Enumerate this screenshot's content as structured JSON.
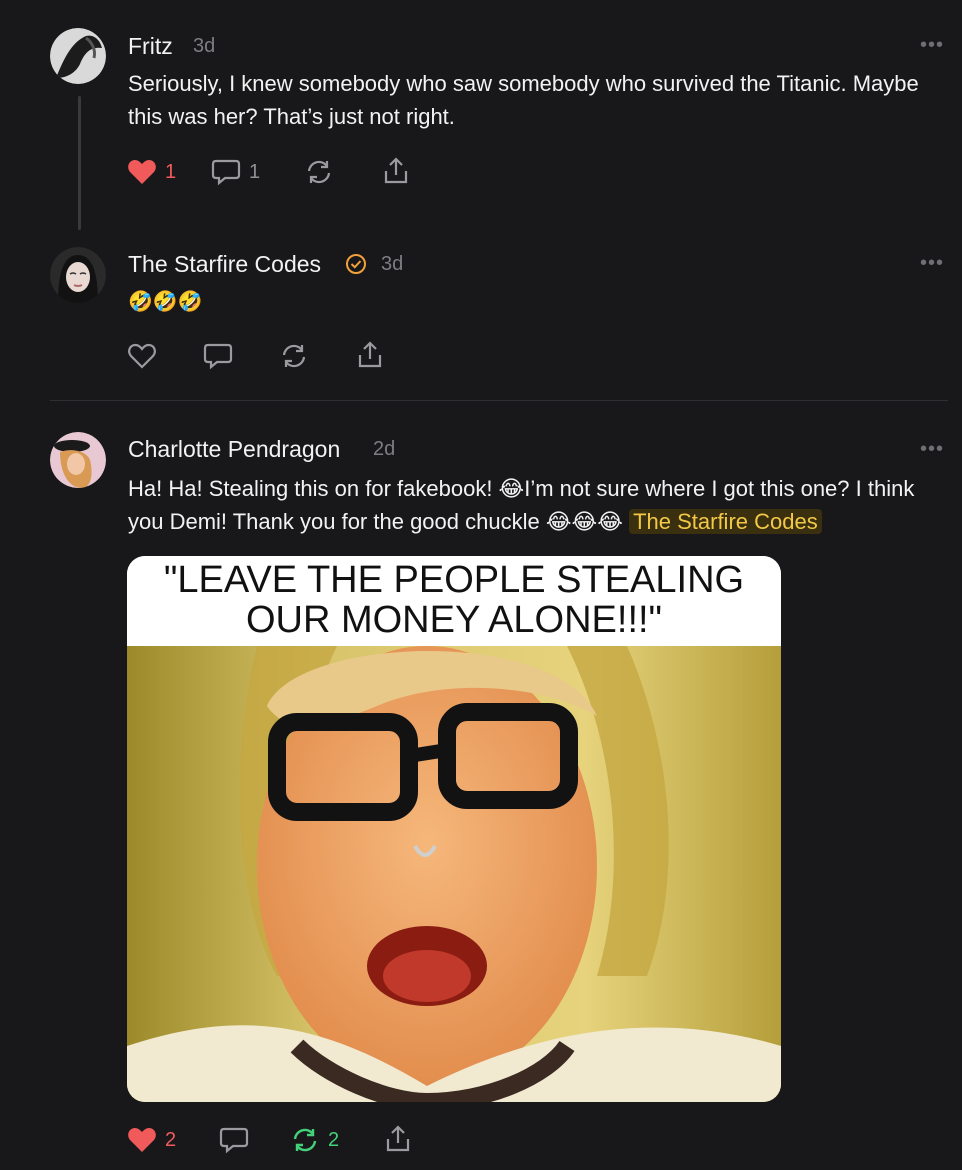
{
  "posts": [
    {
      "author": "Fritz",
      "time": "3d",
      "text": "Seriously, I knew somebody who saw somebody who survived the Titanic. Maybe this was her? That’s just not right.",
      "likes": "1",
      "comments": "1"
    },
    {
      "author": "The Starfire Codes",
      "time": "3d",
      "text": "🤣🤣🤣",
      "verified_icon": "verified-check-icon"
    },
    {
      "author": "Charlotte Pendragon",
      "time": "2d",
      "text_a": "Ha! Ha! Stealing this on for fakebook! 😂I’m not sure where I got this one? I think you Demi! Thank you for the good chuckle 😂😂😂",
      "mention": "The Starfire Codes",
      "meme_caption": "\"LEAVE THE PEOPLE STEALING OUR MONEY ALONE!!!\"",
      "likes": "2",
      "restacks": "2"
    }
  ],
  "more_label": "•••",
  "colors": {
    "like": "#f05a5a",
    "restack": "#43d17a",
    "accent": "#f3a13a",
    "mention": "#f3c847"
  }
}
